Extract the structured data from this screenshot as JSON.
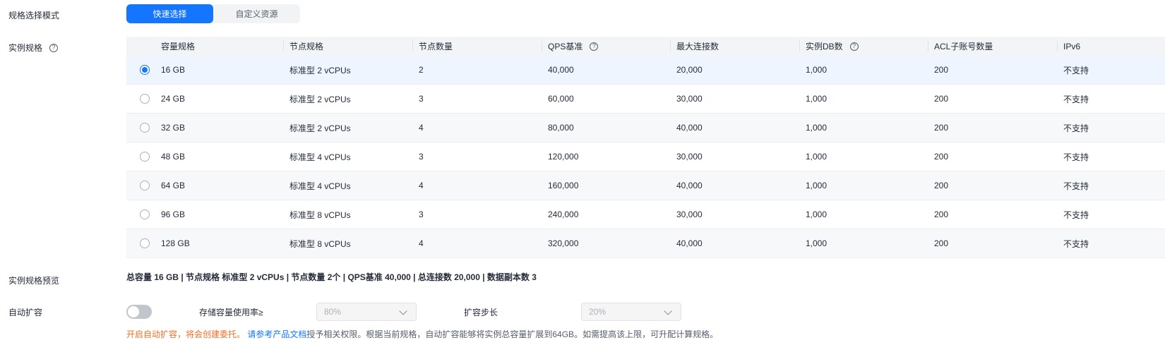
{
  "labels": {
    "mode": "规格选择模式",
    "spec": "实例规格",
    "preview": "实例规格预览",
    "auto_scale": "自动扩容"
  },
  "mode": {
    "options": [
      "快速选择",
      "自定义资源"
    ],
    "selected": 0
  },
  "table": {
    "headers": [
      "容量规格",
      "节点规格",
      "节点数量",
      "QPS基准",
      "最大连接数",
      "实例DB数",
      "ACL子账号数量",
      "IPv6"
    ],
    "rows": [
      [
        "16 GB",
        "标准型 2 vCPUs",
        "2",
        "40,000",
        "20,000",
        "1,000",
        "200",
        "不支持"
      ],
      [
        "24 GB",
        "标准型 2 vCPUs",
        "3",
        "60,000",
        "30,000",
        "1,000",
        "200",
        "不支持"
      ],
      [
        "32 GB",
        "标准型 2 vCPUs",
        "4",
        "80,000",
        "40,000",
        "1,000",
        "200",
        "不支持"
      ],
      [
        "48 GB",
        "标准型 4 vCPUs",
        "3",
        "120,000",
        "30,000",
        "1,000",
        "200",
        "不支持"
      ],
      [
        "64 GB",
        "标准型 4 vCPUs",
        "4",
        "160,000",
        "40,000",
        "1,000",
        "200",
        "不支持"
      ],
      [
        "96 GB",
        "标准型 8 vCPUs",
        "3",
        "240,000",
        "30,000",
        "1,000",
        "200",
        "不支持"
      ],
      [
        "128 GB",
        "标准型 8 vCPUs",
        "4",
        "320,000",
        "40,000",
        "1,000",
        "200",
        "不支持"
      ]
    ],
    "selected_row": 0
  },
  "preview": {
    "text": "总容量 16 GB | 节点规格 标准型 2 vCPUs | 节点数量 2个 | QPS基准 40,000 | 总连接数 20,000 | 数据副本数 3"
  },
  "auto_scale": {
    "enabled": false,
    "usage_label": "存储容量使用率≥",
    "usage_value": "80%",
    "step_label": "扩容步长",
    "step_value": "20%"
  },
  "notice": {
    "warn": "开启自动扩容，将会创建委托。",
    "link": "请参考产品文档",
    "rest": "授予相关权限。根据当前规格，自动扩容能够将实例总容量扩展到64GB。如需提高该上限，可升配计算规格。"
  },
  "colors": {
    "primary": "#1476ff",
    "warn": "#f66f25"
  },
  "icons": {
    "help": "question-circle-icon",
    "chevron": "chevron-down-icon"
  }
}
